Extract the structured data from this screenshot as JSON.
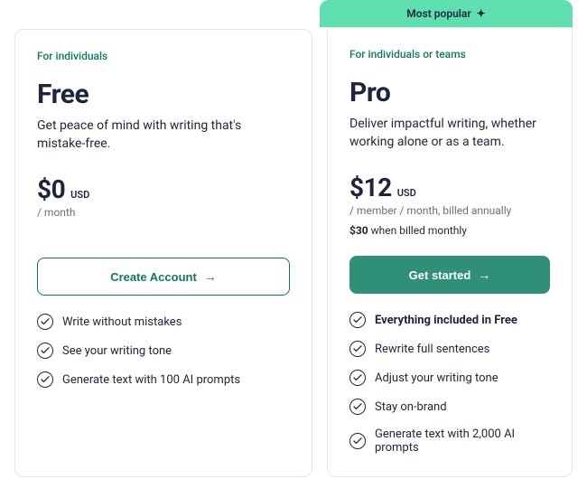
{
  "badge": {
    "label": "Most popular"
  },
  "plans": {
    "free": {
      "audience": "For individuals",
      "name": "Free",
      "desc": "Get peace of mind with writing that's mistake-free.",
      "price": "$0",
      "currency": "USD",
      "period": "/ month",
      "cta": "Create Account",
      "features": [
        "Write without mistakes",
        "See your writing tone",
        "Generate text with 100 AI prompts"
      ]
    },
    "pro": {
      "audience": "For individuals or teams",
      "name": "Pro",
      "desc": "Deliver impactful writing, whether working alone or as a team.",
      "price": "$12",
      "currency": "USD",
      "period": "/ member / month, billed annually",
      "alt_price_bold": "$30",
      "alt_price_rest": " when billed monthly",
      "cta": "Get started",
      "features": [
        "Everything included in Free",
        "Rewrite full sentences",
        "Adjust your writing tone",
        "Stay on-brand",
        "Generate text with 2,000 AI prompts"
      ]
    }
  }
}
